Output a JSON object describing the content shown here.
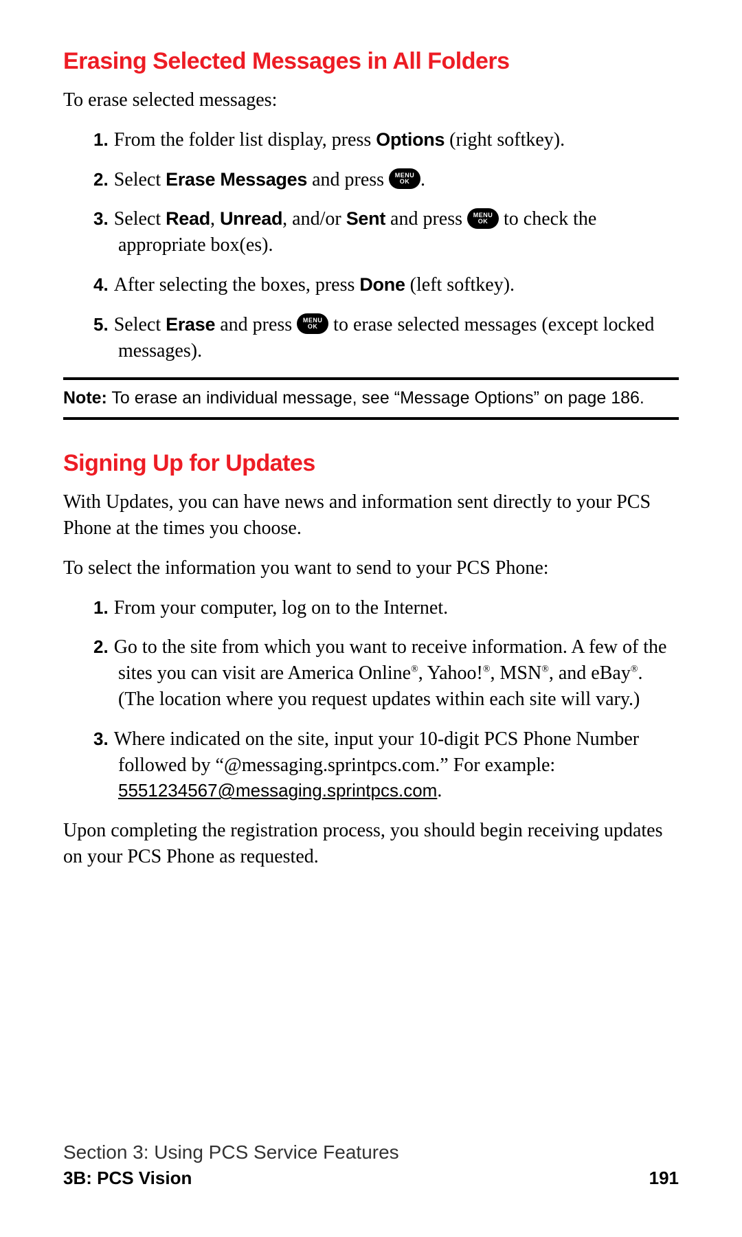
{
  "section1": {
    "heading": "Erasing Selected Messages in All Folders",
    "intro": "To erase selected messages:",
    "steps": {
      "s1_a": "From the folder list display, press ",
      "s1_b": "Options",
      "s1_c": " (right softkey).",
      "s2_a": "Select ",
      "s2_b": "Erase Messages",
      "s2_c": " and press ",
      "s2_d": ".",
      "s3_a": "Select ",
      "s3_b": "Read",
      "s3_c": ", ",
      "s3_d": "Unread",
      "s3_e": ", and/or ",
      "s3_f": "Sent",
      "s3_g": " and press ",
      "s3_h": " to check the appropriate box(es).",
      "s4_a": "After selecting the boxes, press ",
      "s4_b": "Done",
      "s4_c": " (left softkey).",
      "s5_a": "Select ",
      "s5_b": "Erase",
      "s5_c": " and press ",
      "s5_d": " to erase selected messages (except locked messages)."
    },
    "note_label": "Note:",
    "note_text": " To erase an individual message, see “Message Options” on page 186."
  },
  "menuok": {
    "l1": "MENU",
    "l2": "OK"
  },
  "section2": {
    "heading": "Signing Up for Updates",
    "p1": "With Updates, you can have news and information sent directly to your PCS Phone at the times you choose.",
    "p2": "To select the information you want to send to your PCS Phone:",
    "steps": {
      "s1": "From your computer, log on to the Internet.",
      "s2_a": "Go to the site from which you want to receive information. A few of the sites you can visit are America Online",
      "s2_b": ", Yahoo!",
      "s2_c": ", MSN",
      "s2_d": ", and eBay",
      "s2_e": ". (The location where you request updates within each site will vary.)",
      "s3_a": "Where indicated on the site, input your 10-digit PCS Phone Number followed by “@messaging.sprintpcs.com.” For example: ",
      "s3_b": "5551234567@messaging.sprintpcs.com",
      "s3_c": "."
    },
    "p3": "Upon completing the registration process, you should begin receiving updates on your PCS Phone as requested."
  },
  "reg": "®",
  "nums": {
    "n1": "1.",
    "n2": "2.",
    "n3": "3.",
    "n4": "4.",
    "n5": "5."
  },
  "footer": {
    "section": "Section 3: Using PCS Service Features",
    "sub": "3B: PCS Vision",
    "page": "191"
  }
}
